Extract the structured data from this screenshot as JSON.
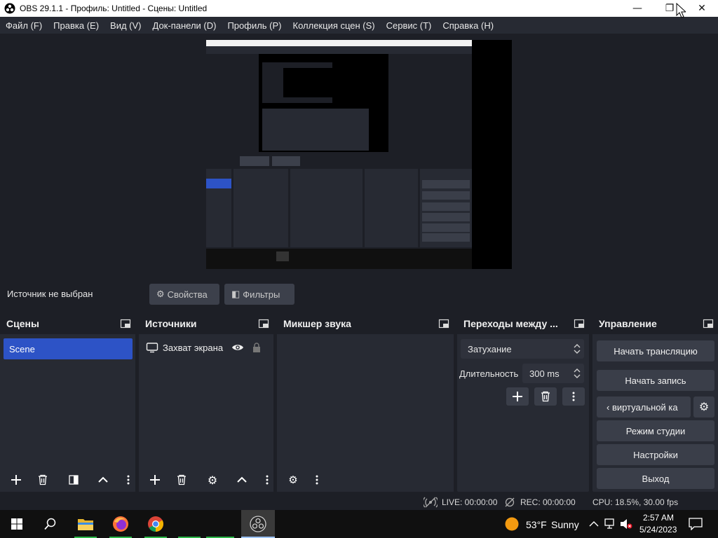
{
  "window": {
    "title": "OBS 29.1.1 - Профиль: Untitled - Сцены: Untitled",
    "minimize": "—",
    "restore": "❐",
    "close": "✕"
  },
  "menu": [
    "Файл (F)",
    "Правка (E)",
    "Вид (V)",
    "Док-панели (D)",
    "Профиль (P)",
    "Коллекция сцен (S)",
    "Сервис (T)",
    "Справка (H)"
  ],
  "context_bar": {
    "no_source": "Источник не выбран",
    "properties": "Свойства",
    "filters": "Фильтры"
  },
  "docks": {
    "scenes": {
      "title": "Сцены",
      "items": [
        "Scene"
      ]
    },
    "sources": {
      "title": "Источники",
      "items": [
        "Захват экрана"
      ]
    },
    "mixer": {
      "title": "Микшер звука"
    },
    "transitions": {
      "title": "Переходы между ...",
      "selected": "Затухание",
      "duration_label": "Длительность",
      "duration_value": "300 ms"
    },
    "controls": {
      "title": "Управление",
      "start_stream": "Начать трансляцию",
      "start_record": "Начать запись",
      "virtual_cam": "‹ виртуальной ка",
      "studio_mode": "Режим студии",
      "settings": "Настройки",
      "exit": "Выход"
    }
  },
  "status": {
    "live": "LIVE: 00:00:00",
    "rec": "REC: 00:00:00",
    "cpu": "CPU: 18.5%, 30.00 fps"
  },
  "taskbar": {
    "weather_temp": "53°F",
    "weather_cond": "Sunny",
    "time": "2:57 AM",
    "date": "5/24/2023"
  },
  "colors": {
    "accent": "#2d53c6",
    "dock_bg": "#272a33",
    "window_bg": "#1d1f26",
    "button_bg": "#3a3e49"
  }
}
